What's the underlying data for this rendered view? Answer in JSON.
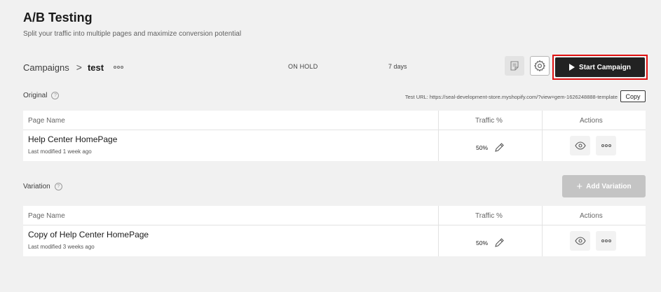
{
  "header": {
    "title": "A/B Testing",
    "subtitle": "Split your traffic into multiple pages and maximize conversion potential"
  },
  "campaign": {
    "breadcrumb_root": "Campaigns",
    "separator": ">",
    "name": "test",
    "status": "ON HOLD",
    "duration": "7 days",
    "start_label": "Start Campaign",
    "highlight_color": "#e01010"
  },
  "original": {
    "label": "Original",
    "help_glyph": "?",
    "test_url": "Test URL: https://seal-development-store.myshopify.com/?view=gem-1626248888-template",
    "copy_label": "Copy",
    "columns": [
      "Page Name",
      "Traffic %",
      "Actions"
    ],
    "rows": [
      {
        "name": "Help Center HomePage",
        "modified": "Last modified 1 week ago",
        "traffic": "50%"
      }
    ]
  },
  "variation": {
    "label": "Variation",
    "help_glyph": "?",
    "add_label": "Add Variation",
    "add_glyph": "+",
    "columns": [
      "Page Name",
      "Traffic %",
      "Actions"
    ],
    "rows": [
      {
        "name": "Copy of Help Center HomePage",
        "modified": "Last modified 3 weeks ago",
        "traffic": "50%"
      }
    ]
  },
  "icons": {
    "campaign_menu": "more-dots-icon",
    "notes": "notes-icon",
    "settings": "gear-icon",
    "start": "play-icon",
    "edit": "pencil-icon",
    "preview": "eye-icon",
    "row_menu": "more-dots-icon"
  }
}
